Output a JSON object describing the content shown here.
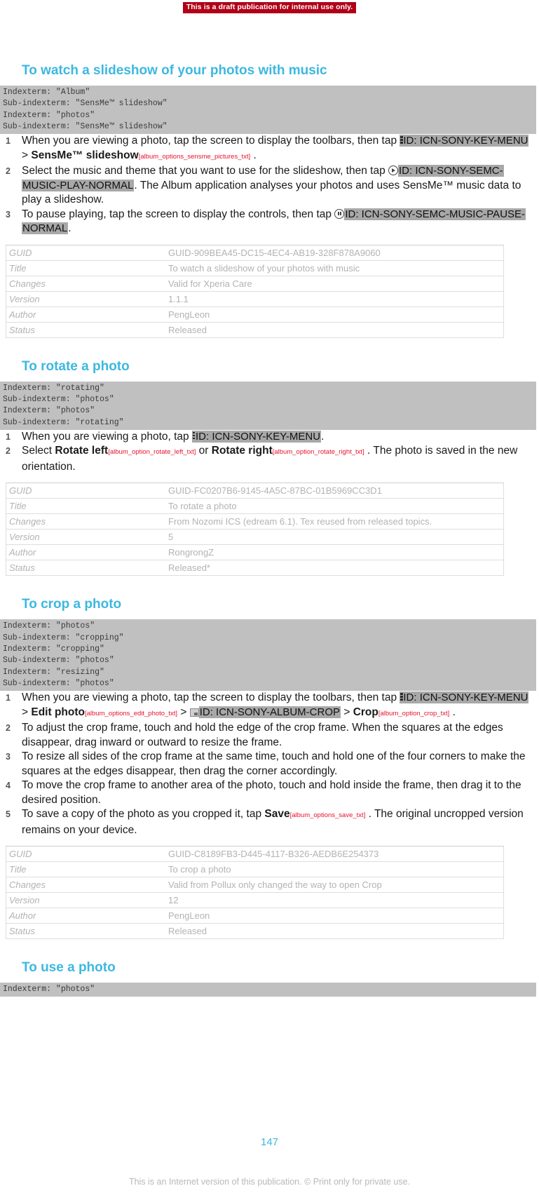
{
  "banner": {
    "text": "This is a draft publication for internal use only."
  },
  "colors": {
    "heading": "#3cb8e0",
    "banner_bg": "#b00018",
    "indexterm_bg": "#c0c0c0",
    "id_token_bg": "#a8a8a8",
    "varref": "#e8112d",
    "meta_text": "#b3b3b3"
  },
  "sections": [
    {
      "heading": "To watch a slideshow of your photos with music",
      "indexterms": [
        "Indexterm: \"Album\"",
        "Sub-indexterm: \"SensMe™ slideshow\"",
        "Indexterm: \"photos\"",
        "Sub-indexterm: \"SensMe™ slideshow\""
      ],
      "steps": [
        {
          "num": "1",
          "p1": "When you are viewing a photo, tap the screen to display the toolbars, then tap ",
          "id1": "ID: ICN-SONY-KEY-MENU",
          "sep1": " > ",
          "ui1": "SensMe™ slideshow",
          "var1": "[album_options_sensme_pictures_txt]",
          "tail": " ."
        },
        {
          "num": "2",
          "p1": "Select the music and theme that you want to use for the slideshow, then tap ",
          "id1": "ID: ICN-SONY-SEMC-MUSIC-PLAY-NORMAL",
          "tail": ". The Album application analyses your photos and uses SensMe™ music data to play a slideshow."
        },
        {
          "num": "3",
          "p1": "To pause playing, tap the screen to display the controls, then tap ",
          "id1": "ID: ICN-SONY-SEMC-MUSIC-PAUSE-NORMAL",
          "tail": "."
        }
      ],
      "meta": [
        {
          "key": "GUID",
          "value": "GUID-909BEA45-DC15-4EC4-AB19-328F878A9060"
        },
        {
          "key": "Title",
          "value": "To watch a slideshow of your photos with music"
        },
        {
          "key": "Changes",
          "value": "Valid for Xperia Care"
        },
        {
          "key": "Version",
          "value": "1.1.1"
        },
        {
          "key": "Author",
          "value": "PengLeon"
        },
        {
          "key": "Status",
          "value": "Released"
        }
      ]
    },
    {
      "heading": "To rotate a photo",
      "indexterms": [
        "Indexterm: \"rotating\"",
        "Sub-indexterm: \"photos\"",
        "Indexterm: \"photos\"",
        "Sub-indexterm: \"rotating\""
      ],
      "steps": [
        {
          "num": "1",
          "p1": "When you are viewing a photo, tap ",
          "id1": "ID: ICN-SONY-KEY-MENU",
          "tail": "."
        },
        {
          "num": "2",
          "p1": "Select ",
          "ui1": "Rotate left",
          "var1": "[album_option_rotate_left_txt]",
          "mid": " or ",
          "ui2": "Rotate right",
          "var2": "[album_option_rotate_right_txt]",
          "tail": " . The photo is saved in the new orientation."
        }
      ],
      "meta": [
        {
          "key": "GUID",
          "value": "GUID-FC0207B6-9145-4A5C-87BC-01B5969CC3D1"
        },
        {
          "key": "Title",
          "value": "To rotate a photo"
        },
        {
          "key": "Changes",
          "value": "From Nozomi ICS (edream 6.1). Tex reused from released topics."
        },
        {
          "key": "Version",
          "value": "5"
        },
        {
          "key": "Author",
          "value": "RongrongZ"
        },
        {
          "key": "Status",
          "value": "Released*"
        }
      ]
    },
    {
      "heading": "To crop a photo",
      "indexterms": [
        "Indexterm: \"photos\"",
        "Sub-indexterm: \"cropping\"",
        "Indexterm: \"cropping\"",
        "Sub-indexterm: \"photos\"",
        "Indexterm: \"resizing\"",
        "Sub-indexterm: \"photos\""
      ],
      "steps": [
        {
          "num": "1",
          "p1": "When you are viewing a photo, tap the screen to display the toolbars, then tap ",
          "id1": "ID: ICN-SONY-KEY-MENU",
          "sep1": " > ",
          "ui1": "Edit photo",
          "var1": "[album_options_edit_photo_txt]",
          "sep2": " > ",
          "id2": "ID: ICN-SONY-ALBUM-CROP",
          "sep3": " > ",
          "ui2": "Crop",
          "var2": "[album_option_crop_txt]",
          "tail": " ."
        },
        {
          "num": "2",
          "p1": "To adjust the crop frame, touch and hold the edge of the crop frame. When the squares at the edges disappear, drag inward or outward to resize the frame."
        },
        {
          "num": "3",
          "p1": "To resize all sides of the crop frame at the same time, touch and hold one of the four corners to make the squares at the edges disappear, then drag the corner accordingly."
        },
        {
          "num": "4",
          "p1": "To move the crop frame to another area of the photo, touch and hold inside the frame, then drag it to the desired position."
        },
        {
          "num": "5",
          "p1": "To save a copy of the photo as you cropped it, tap ",
          "ui1": "Save",
          "var1": "[album_options_save_txt]",
          "tail": " . The original uncropped version remains on your device."
        }
      ],
      "meta": [
        {
          "key": "GUID",
          "value": "GUID-C8189FB3-D445-4117-B326-AEDB6E254373"
        },
        {
          "key": "Title",
          "value": "To crop a photo"
        },
        {
          "key": "Changes",
          "value": "Valid from Pollux only changed the way to open Crop"
        },
        {
          "key": "Version",
          "value": "12"
        },
        {
          "key": "Author",
          "value": "PengLeon"
        },
        {
          "key": "Status",
          "value": "Released"
        }
      ]
    },
    {
      "heading": "To use a photo",
      "indexterms": [
        "Indexterm: \"photos\""
      ],
      "steps": [],
      "meta": []
    }
  ],
  "footer": {
    "page_number": "147",
    "note": "This is an Internet version of this publication. © Print only for private use."
  }
}
